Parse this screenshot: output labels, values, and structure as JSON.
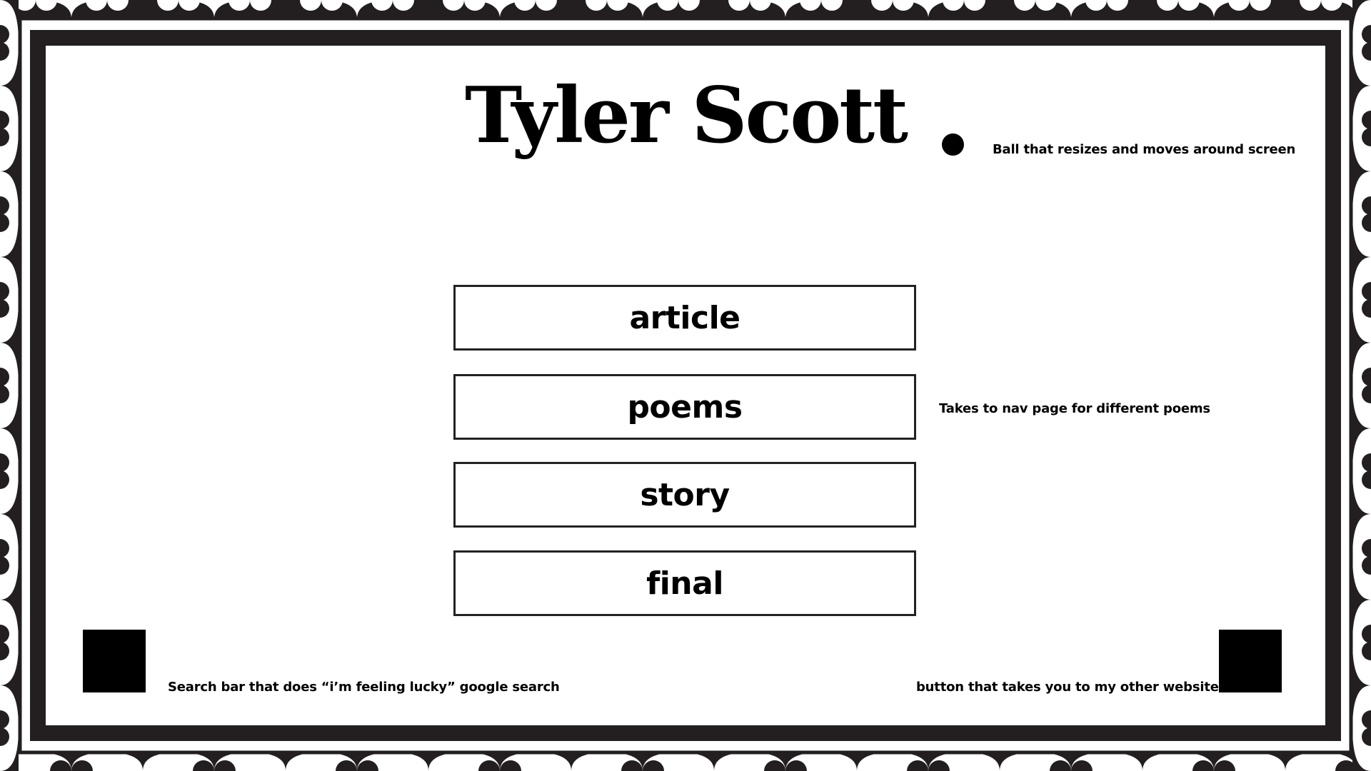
{
  "header": {
    "title": "Tyler Scott",
    "ball_note": "Ball that resizes and moves around screen"
  },
  "nav": {
    "items": [
      {
        "label": "article"
      },
      {
        "label": "poems"
      },
      {
        "label": "story"
      },
      {
        "label": "final"
      }
    ],
    "poems_note": "Takes to nav page for different poems"
  },
  "footer": {
    "search_note": "Search bar that does “i’m feeling lucky” google search",
    "website_note": "button that takes you to my other website"
  },
  "colors": {
    "ink": "#000000",
    "frame": "#231f20",
    "paper": "#ffffff"
  }
}
